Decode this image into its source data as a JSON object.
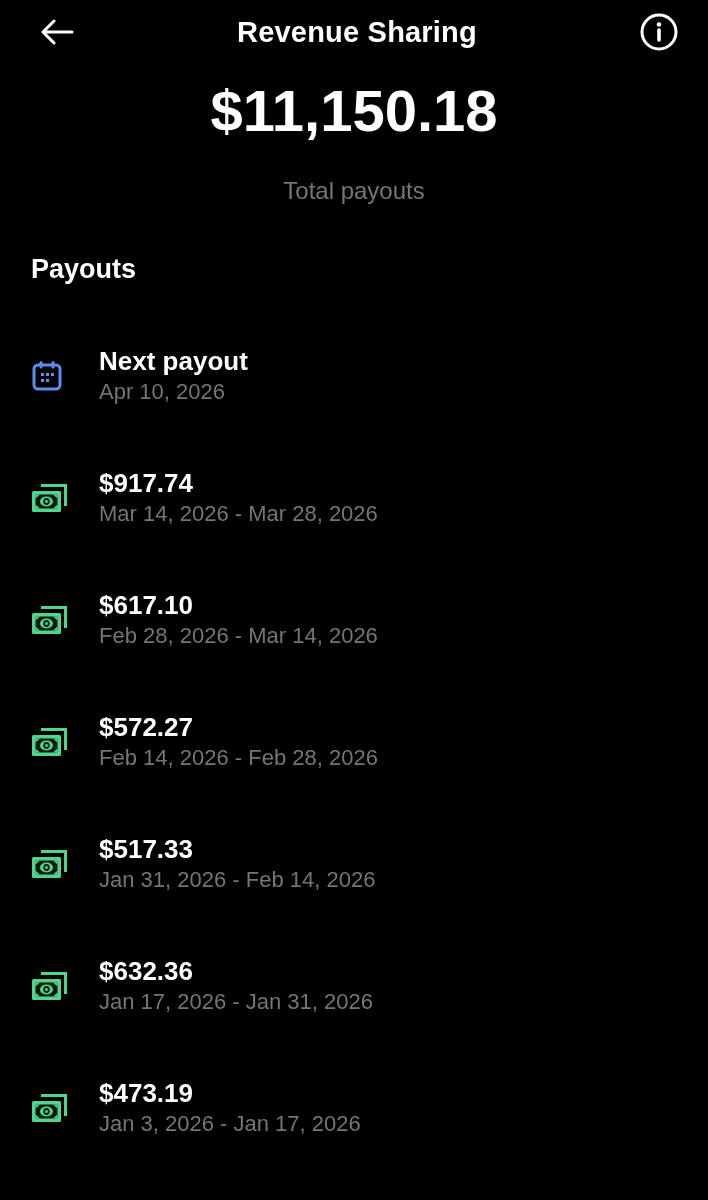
{
  "header": {
    "title": "Revenue Sharing"
  },
  "summary": {
    "amount": "$11,150.18",
    "label": "Total payouts"
  },
  "payouts": {
    "heading": "Payouts",
    "items": [
      {
        "kind": "scheduled",
        "title": "Next payout",
        "subtitle": "Apr 10, 2026"
      },
      {
        "kind": "paid",
        "title": "$917.74",
        "subtitle": "Mar 14, 2026 - Mar 28, 2026"
      },
      {
        "kind": "paid",
        "title": "$617.10",
        "subtitle": "Feb 28, 2026 - Mar 14, 2026"
      },
      {
        "kind": "paid",
        "title": "$572.27",
        "subtitle": "Feb 14, 2026 - Feb 28, 2026"
      },
      {
        "kind": "paid",
        "title": "$517.33",
        "subtitle": "Jan 31, 2026 - Feb 14, 2026"
      },
      {
        "kind": "paid",
        "title": "$632.36",
        "subtitle": "Jan 17, 2026 - Jan 31, 2026"
      },
      {
        "kind": "paid",
        "title": "$473.19",
        "subtitle": "Jan 3, 2026 - Jan 17, 2026"
      }
    ]
  }
}
